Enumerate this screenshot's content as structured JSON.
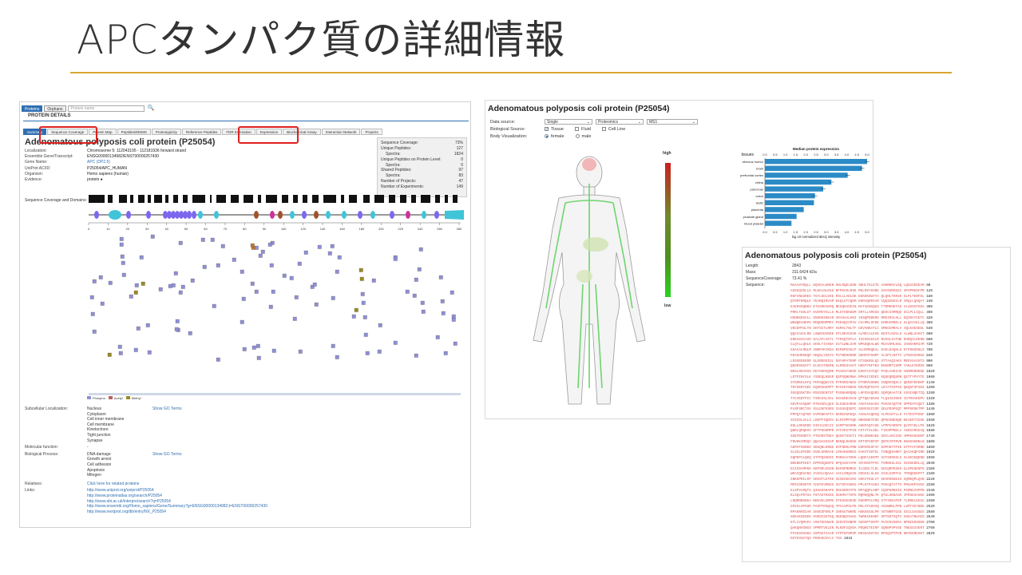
{
  "slide": {
    "title": "APCタンパク質の詳細情報"
  },
  "panel1": {
    "topbar": {
      "tab_proteins": "Proteins",
      "tab_orphans": "Orphans",
      "search_placeholder": "Protein name"
    },
    "heading": "PROTEIN DETAILS",
    "tabs": [
      "Summary",
      "Sequence Coverage",
      "Protein Map",
      "Peptides/MSMS",
      "Proteotypicity",
      "Reference Peptides",
      "FDR Estimation",
      "Expression",
      "Biochemical Assay",
      "Interaction Network",
      "Projects"
    ],
    "protein_title": "Adenomatous polyposis coli protein (P25054)",
    "info": [
      {
        "key": "Localization:",
        "value": "Chromosome 5: 112043195 - 112181936 forward strand",
        "link": false
      },
      {
        "key": "Ensemble Gene/Transcript:",
        "value": "ENSG00000134982/ENST00000257430",
        "link": false
      },
      {
        "key": "Gene Name:",
        "value": "APC (DP2.5)",
        "link": false
      },
      {
        "key": "UniProt AC/ID:",
        "value": "P25054/APC_HUMAN",
        "link": false
      },
      {
        "key": "Organism:",
        "value": "Homo sapiens (human)",
        "link": false
      },
      {
        "key": "Evidence:",
        "value": "protein ●",
        "link": false
      }
    ],
    "stats": [
      {
        "key": "Sequence Coverage:",
        "value": "73%",
        "indent": false
      },
      {
        "key": "Unique Peptides:",
        "value": "127",
        "indent": false
      },
      {
        "key": "Spectra:",
        "value": "1824",
        "indent": true
      },
      {
        "key": "Unique Peptides on Protein Level:",
        "value": "0",
        "indent": false
      },
      {
        "key": "Spectra:",
        "value": "0",
        "indent": true
      },
      {
        "key": "Shared Peptides:",
        "value": "97",
        "indent": false
      },
      {
        "key": "Spectra:",
        "value": "83",
        "indent": true
      },
      {
        "key": "Number of Projects:",
        "value": "47",
        "indent": false
      },
      {
        "key": "Number of Experiments:",
        "value": "149",
        "indent": false
      }
    ],
    "sequence_label": "Sequence Coverage and Domains:",
    "axis_ticks": [
      "0",
      "10",
      "20",
      "30",
      "40",
      "50",
      "60",
      "70",
      "80",
      "90",
      "100",
      "120",
      "140",
      "160",
      "180",
      "200",
      "220",
      "240",
      "260",
      "280"
    ],
    "legend": [
      "Phospho",
      "Acetyl",
      "Methyl"
    ],
    "subcellular": {
      "label": "Subcellular Localization:",
      "items": [
        "Nucleus",
        "Cytoplasm",
        "Cell inner membrane",
        "Cell membrane",
        "Kinetochore",
        "Tight junction",
        "Synapse"
      ],
      "go": "Show GO Terms"
    },
    "molecular": {
      "label": "Molecular function:",
      "value": "-"
    },
    "biological": {
      "label": "Biological Process:",
      "items": [
        "DNA damage",
        "Growth arrest",
        "Cell adhesion",
        "Apoptosis",
        "Mitogen"
      ],
      "go": "Show GO Terms"
    },
    "relatives": {
      "label": "Relatives:",
      "value": "Click here for related proteins"
    },
    "links": {
      "label": "Links:",
      "items": [
        "http://www.uniprot.org/uniprot/P25054",
        "http://www.proteinatlas.org/search/P25054",
        "http://www.ebi.ac.uk/interpro/search?q=P25054",
        "http://www.ensembl.org/Homo_sapiens/Gene/Summary?g=ENSG00000134982;t=ENST00000257430",
        "http://www.nextprot.org/db/entry/NX_P25054"
      ]
    },
    "colors": {
      "accent": "#2f6fb2",
      "highlight": "#e02020",
      "domain": "#7b68ee",
      "domain_cyan": "#40c4d8"
    }
  },
  "panel2": {
    "title": "Adenomatous polyposis coli protein (P25054)",
    "data_source_label": "Data source:",
    "selects": [
      "Single",
      "Proteomics",
      "MS1"
    ],
    "bio_source_label": "Biological Source:",
    "bio_options": [
      {
        "label": "Tissue",
        "checked": true
      },
      {
        "label": "Fluid",
        "checked": false
      },
      {
        "label": "Cell Line",
        "checked": false
      }
    ],
    "body_vis_label": "Body Visualization:",
    "body_options": [
      {
        "label": "female",
        "checked": true
      },
      {
        "label": "male",
        "checked": false
      }
    ],
    "heat_high": "high",
    "heat_low": "low",
    "chart_labels": {
      "panel_title": "Median protein expression",
      "y_title": "tissues",
      "x_title": "log 10 normalized iBAQ intensity",
      "ticks": [
        "0.0",
        "0.5",
        "1.0",
        "1.5",
        "2.0",
        "2.5",
        "3.0",
        "3.5",
        "4.0",
        "4.5",
        "5.0"
      ]
    }
  },
  "chart_data": {
    "type": "bar",
    "title": "Median protein expression",
    "xlabel": "log 10 normalized iBAQ intensity",
    "ylabel": "tissues",
    "orientation": "horizontal",
    "categories": [
      "vitreous humor",
      "brain",
      "prefrontal cortex",
      "retina",
      "pancreas",
      "colon",
      "testis",
      "placenta",
      "prostate gland",
      "blood platelet"
    ],
    "values": [
      5.0,
      4.75,
      4.05,
      3.25,
      2.85,
      2.45,
      2.4,
      1.9,
      1.55,
      1.3
    ],
    "xlim": [
      0,
      5
    ],
    "bar_color": "#2b8bc6",
    "grid": false
  },
  "panel3": {
    "title": "Adenomatous polyposis coli protein (P25054)",
    "info": [
      {
        "key": "Length:",
        "value": "2843"
      },
      {
        "key": "Mass:",
        "value": "311.6424 kDa"
      },
      {
        "key": "SequenceCoverage:",
        "value": "73.41 %"
      },
      {
        "key": "Sequence:",
        "value": ""
      }
    ],
    "sequence_rows": [
      {
        "text": "MAAASYDQLL KQVEALKMEN SNLRQELEDN SNHLTKLETE ASNMKEVLKQ LQGSIEDEAM",
        "end": "60"
      },
      {
        "text": "ASSGQIDLLE RLKELNLDSS NFPGVKLRSK MSLRSYGSRE GSVSSRSGEC SPVPMGSFPR",
        "end": "120"
      },
      {
        "text": "RGFVNGSRES TGYLEELEKE RSLLLADLDK EEKEKDWYYA QLQNLTKRID SLPLTENFSL",
        "end": "180"
      },
      {
        "text": "QTDMTRRQLE YEARQIRVAM EEQLGTCQDM EKRAQRRIAR IQQIEKDILR IRQLLQSQAT",
        "end": "240"
      },
      {
        "text": "EAERSSQNKH ETGSHDAERQ NEGQGVGEIN MATSGNGQGS TTRMDHETAS VLSSSSTHSA",
        "end": "300"
      },
      {
        "text": "PRRLTSHLGT KVEMVYSLLS MLGTHDKDDM SRTLLAMSSS QDSCISMRQS GCLPLLIQLL",
        "end": "360"
      },
      {
        "text": "HGNDKDSVLL GNSRGSKEAR ARASAALHNI IHSQPDDKRG RREIRVLHLL EQIRAYCETC",
        "end": "420"
      },
      {
        "text": "WEWQEAHEPG MDQDKNPMPA PVEHQICPAV CVLMKLSFDE EHRHAMNELG GLQAIAELLQ",
        "end": "480"
      },
      {
        "text": "VDCEMYGLTN DHYSITLRRY AGMALTNLTF GDVANKATLC SMKGCMRALV AQLKSESEDL",
        "end": "540"
      },
      {
        "text": "QQVIASVLRN LSWRADVNSK KTLREVGSVK ALMECALEVK KESTLKSVLS ALWNLSAHCT",
        "end": "600"
      },
      {
        "text": "ENKADICAVD GALAFLVGTL TYRSQTNTLA IIESGGGILR NVSSLIATNE DHRQILRENN",
        "end": "660"
      },
      {
        "text": "CLQTLLQHLK SHSLTIVSNA CGTLWNLSAR NPKDQEALWD MGAVSMLKNL IHSKHKMIAM",
        "end": "720"
      },
      {
        "text": "GSAAALRNLM ANRPAKYKDA NIMSPGSSLP SLHVRKQKAL EAELDAQHLS ETFDNIDNLS",
        "end": "780"
      },
      {
        "text": "PKASHRSKQR HKQSLYGDYV FDTNRHDDNR SDNFNTGNMT VLSPYLNTTV LPSSSSSRGS",
        "end": "840"
      },
      {
        "text": "LDSSRSEKDR SLERERGIGL GNYHPATENP GTSSKRGLQI STTAAQIAKV MEEVSAIHTS",
        "end": "900"
      },
      {
        "text": "QEDRSSGSTT ELHCVTDERN ALRRSSAAHT HSNTYNFTKS ENSNRTCSMP YAKLEYKRSS",
        "end": "960"
      },
      {
        "text": "NDSLNSVSSS DGYGKRGQMK PSIESYSEDD ESKFCSYGQY PADLAHKIHS ANHMDDNDGE",
        "end": "1020"
      },
      {
        "text": "LDTPINYSLK YSDEQLNSGR QSPSQNERWA RPKHIIEDEI KQSEQRQSRN QSTTYPVYTE",
        "end": "1080"
      },
      {
        "text": "STDDKHLKFQ PHFGQQECVS PYRSRGANGS ETNRVGSNHG INQNVSQSLC QEDDYEDDKP",
        "end": "1140"
      },
      {
        "text": "TNYSERYSEE EQHEEEERPT NYSIKYNEEK RHVDQPIDYS LKYATDIPSS QKQSFSFSKS",
        "end": "1200"
      },
      {
        "text": "SSGQSSKTEH MSSSSENTST PSSNAKRQNQ LHPSSAQSRS GQPQKAATCK VSSINQETIQ",
        "end": "1260"
      },
      {
        "text": "TYCVEDTPIC FSRCSSLSSL SSAEDEIGCN QTTQEADSAN TLQIAEIKEK IGTRSAEDPV",
        "end": "1320"
      },
      {
        "text": "SEVPAVSQHP RTKSSRLQGS SLSSESARHK AVEFSSGAKS PSKSGAQTPK SPPEHYVQET",
        "end": "1380"
      },
      {
        "text": "PLMFSRCTSV SSLDSFESRS IASSVQSEPC SGMVSGIISP SDLPDSPGQT MPPSRSKTPP",
        "end": "1440"
      },
      {
        "text": "PPPQTAQTKR EVPKNKAPTA EKRESGPKQA AVNAAVQRVQ VLPDADTLLH FATESTPDGF",
        "end": "1500"
      },
      {
        "text": "SCSSSLSALS LDEPFIQKDV ELRIMPPVQE NDNGNETESE QPKESNENQE KEAEKTIDSE",
        "end": "1560"
      },
      {
        "text": "KDLLDDSDDD DIEILEECII SAMPTKSSRK AKKPAQTASK LPPPVARKPS QLPVYKLLPS",
        "end": "1620"
      },
      {
        "text": "QNRLQPQKHV SFTPGDDMPR VYCVEGTPIN FSTATSLSDL TIESPPNELA AGEGVRGGAQ",
        "end": "1680"
      },
      {
        "text": "SGEFEKRDTI PTEGRSTDEA QGGKTSSVTI PELDDNKAEE GDILAECINS AMPKGKSHKP",
        "end": "1740"
      },
      {
        "text": "FRVKKIMDQV QQASASSSAP NKNQLDGKKK KPTSPVKPIP QNTEYRTRVR KNADSKNNLN",
        "end": "1800"
      },
      {
        "text": "AERVFSDNKD SKKQNLKNNS KVFNDKLPNN EDRVRGSFAF DSPHHYTPIE GTPYCFSRND",
        "end": "1860"
      },
      {
        "text": "SLSSLDFDDD DVDLSREKAE LRKAKENKES EAKVTSHTEL TSNQQSANKT QAIAKQPINR",
        "end": "1920"
      },
      {
        "text": "GQPKPILQKQ STFPQSSKDI PDRGAATDEK LQNFAIENTP VCFSHNSSLS SLSDIDQENN",
        "end": "1980"
      },
      {
        "text": "NKENEPIKET EPPDSQGEPS KPQASGYAPK SFHVEDTPVC FSRNSSLSSL SIDSEDDLLQ",
        "end": "2040"
      },
      {
        "text": "ECISSAMPKK KKPSRLKGDN EKHSPRNMGG ILGEDLTLDL KDIQRPDSEH GLSPDSENFD",
        "end": "2100"
      },
      {
        "text": "WKAIQEGANS IVSSLHQAAA AACLSRQASS DSDSILSLKS GISLGSPFHL TPDQEEKPFT",
        "end": "2160"
      },
      {
        "text": "SNKGPRILKP GEKSTLETKK IESESKGIKG GKKVYKSLIT GKVRSNSEIS GQMKQPLQAN",
        "end": "2220"
      },
      {
        "text": "MPSISRGRTM IHIPGVRNSS SSTSPVSKKG PPLKTPASKS PSEGQTATTS PRGAKPSVKS",
        "end": "2280"
      },
      {
        "text": "ELSPVARQTS QIGGSSKAPS RSGSRDSTPS RPAQQPLSRP IQSPGRNSIS PGRNGISPPN",
        "end": "2340"
      },
      {
        "text": "KLSQLPRTSS PSTASTKSSG SGKMSYTSPG RQMSQQNLTK QTGLSKNASS IPRSESASKG",
        "end": "2400"
      },
      {
        "text": "LNQMNNGNGA NKKVELSRMS STKSSGSESD RSERPVLVRQ STFIKEAPSP TLRRKLEESA",
        "end": "2460"
      },
      {
        "text": "SFESLSPSSR PASPTRSQAQ TPVLSPSLPD MSLSTHSSVQ AGGWRKLPPN LSPTIEYNDG",
        "end": "2520"
      },
      {
        "text": "RPAKRHDIAR SHSESPSRLP INRSGTWKRE HSKHSSSLPR VSTWRRTGSS SSILSASSES",
        "end": "2580"
      },
      {
        "text": "SEKAKSEDEK HVNSISGTKQ SKENQVSAKG TWRKIKENEF SPTNSTSQTV SSGATNGAES",
        "end": "2640"
      },
      {
        "text": "KTLIYQMAPA VSKTEDVWVR IEDCPINNPR SGRSPTGNTP PVIDSVSEKA NPNIKDSKDN",
        "end": "2700"
      },
      {
        "text": "QAKQNVGNGS VPMRTVGLEN RLNSFIQVDA PDQKGTEIKP GQNNPVPVSE TNESSIVERT",
        "end": "2760"
      },
      {
        "text": "PFSSSSSSKH SSPSGTVAAR VTPFNYNPSP RKSSADSTSA RPSQIPTPVN NNTKKRDSKT",
        "end": "2820"
      },
      {
        "text": "DSTESSGTQS PKRHSGSYLV TSV",
        "end": "2843"
      }
    ]
  }
}
